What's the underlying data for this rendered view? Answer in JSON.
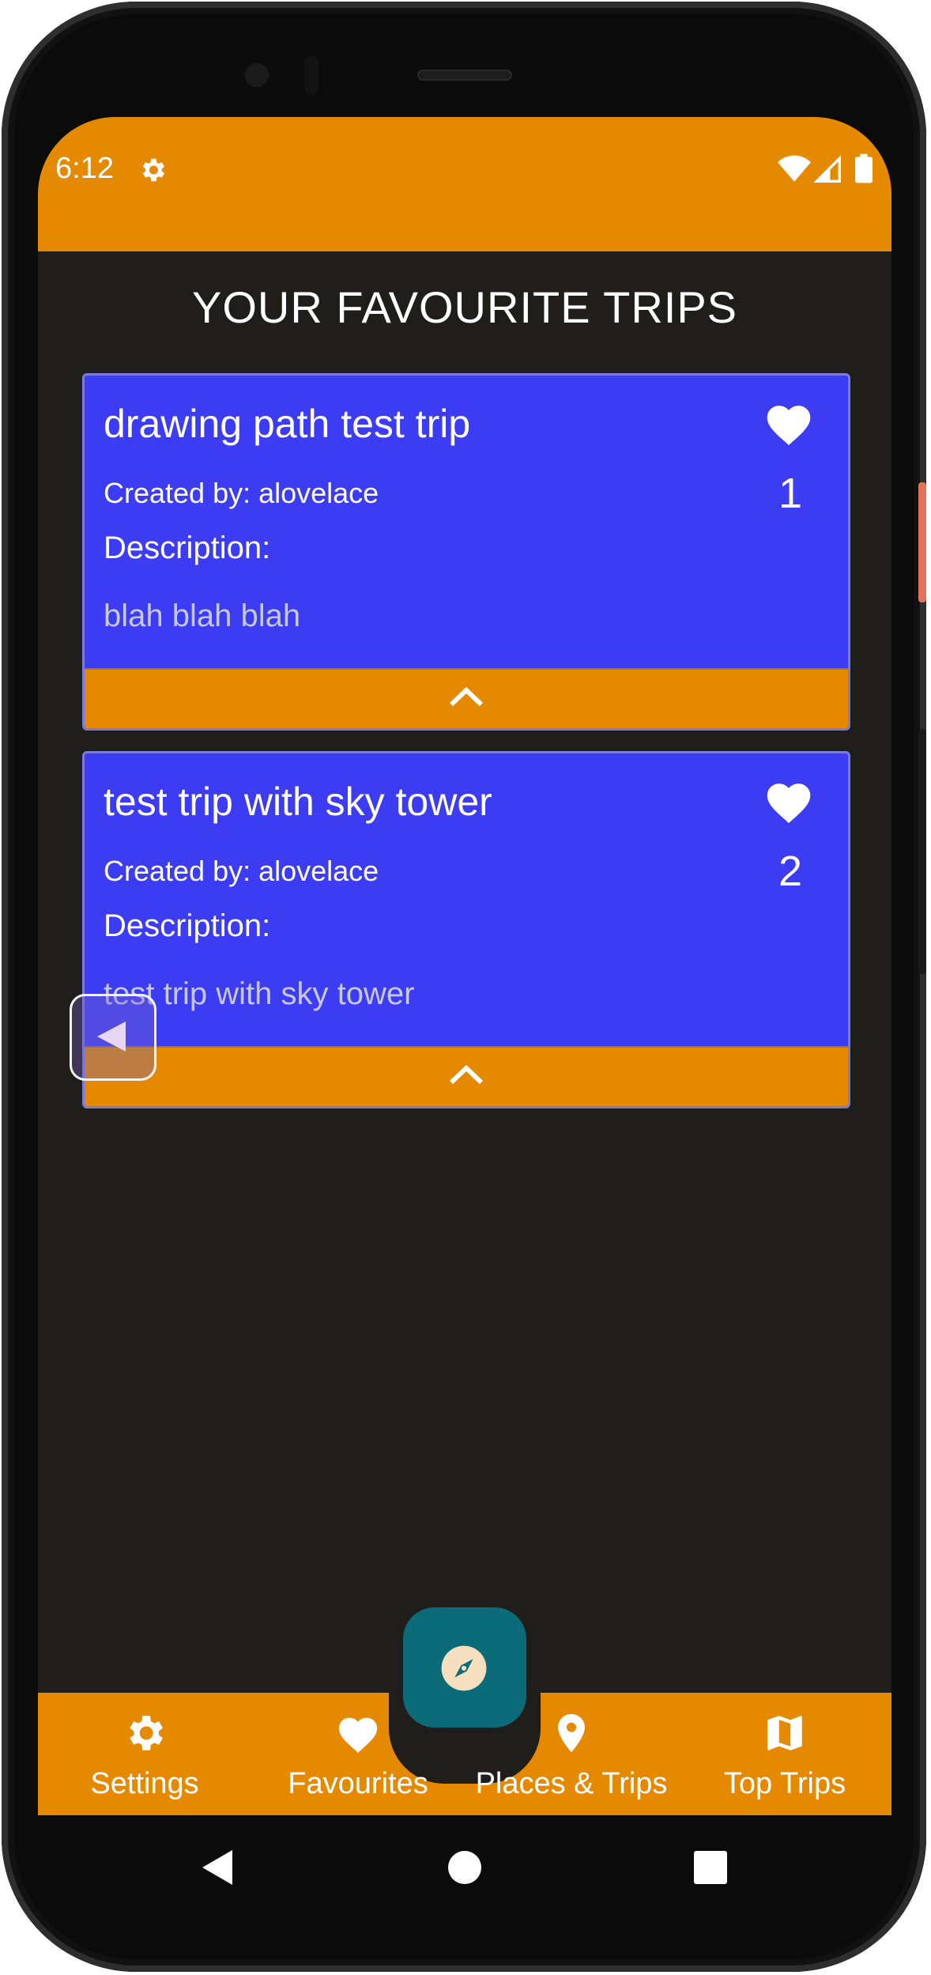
{
  "status_bar": {
    "time": "6:12",
    "icons": [
      "settings-gear-icon",
      "wifi-icon",
      "signal-icon",
      "battery-icon"
    ]
  },
  "page": {
    "title": "YOUR FAVOURITE TRIPS"
  },
  "trips": [
    {
      "title": "drawing path test trip",
      "creator": "Created by: alovelace",
      "description_label": "Description:",
      "description": "blah blah blah",
      "favourite_count": "1"
    },
    {
      "title": "test trip with sky tower",
      "creator": "Created by: alovelace",
      "description_label": "Description:",
      "description": "test trip with sky tower",
      "favourite_count": "2"
    }
  ],
  "bottom_nav": {
    "items": [
      {
        "label": "Settings",
        "icon": "gear-icon"
      },
      {
        "label": "Favourites",
        "icon": "heart-icon"
      },
      {
        "label": "Places & Trips",
        "icon": "location-pin-icon"
      },
      {
        "label": "Top Trips",
        "icon": "map-icon"
      }
    ],
    "fab_icon": "compass-icon"
  },
  "colors": {
    "accent": "#e58a00",
    "card": "#3c3cf2",
    "background": "#201e1a",
    "fab": "#0c6b78"
  }
}
